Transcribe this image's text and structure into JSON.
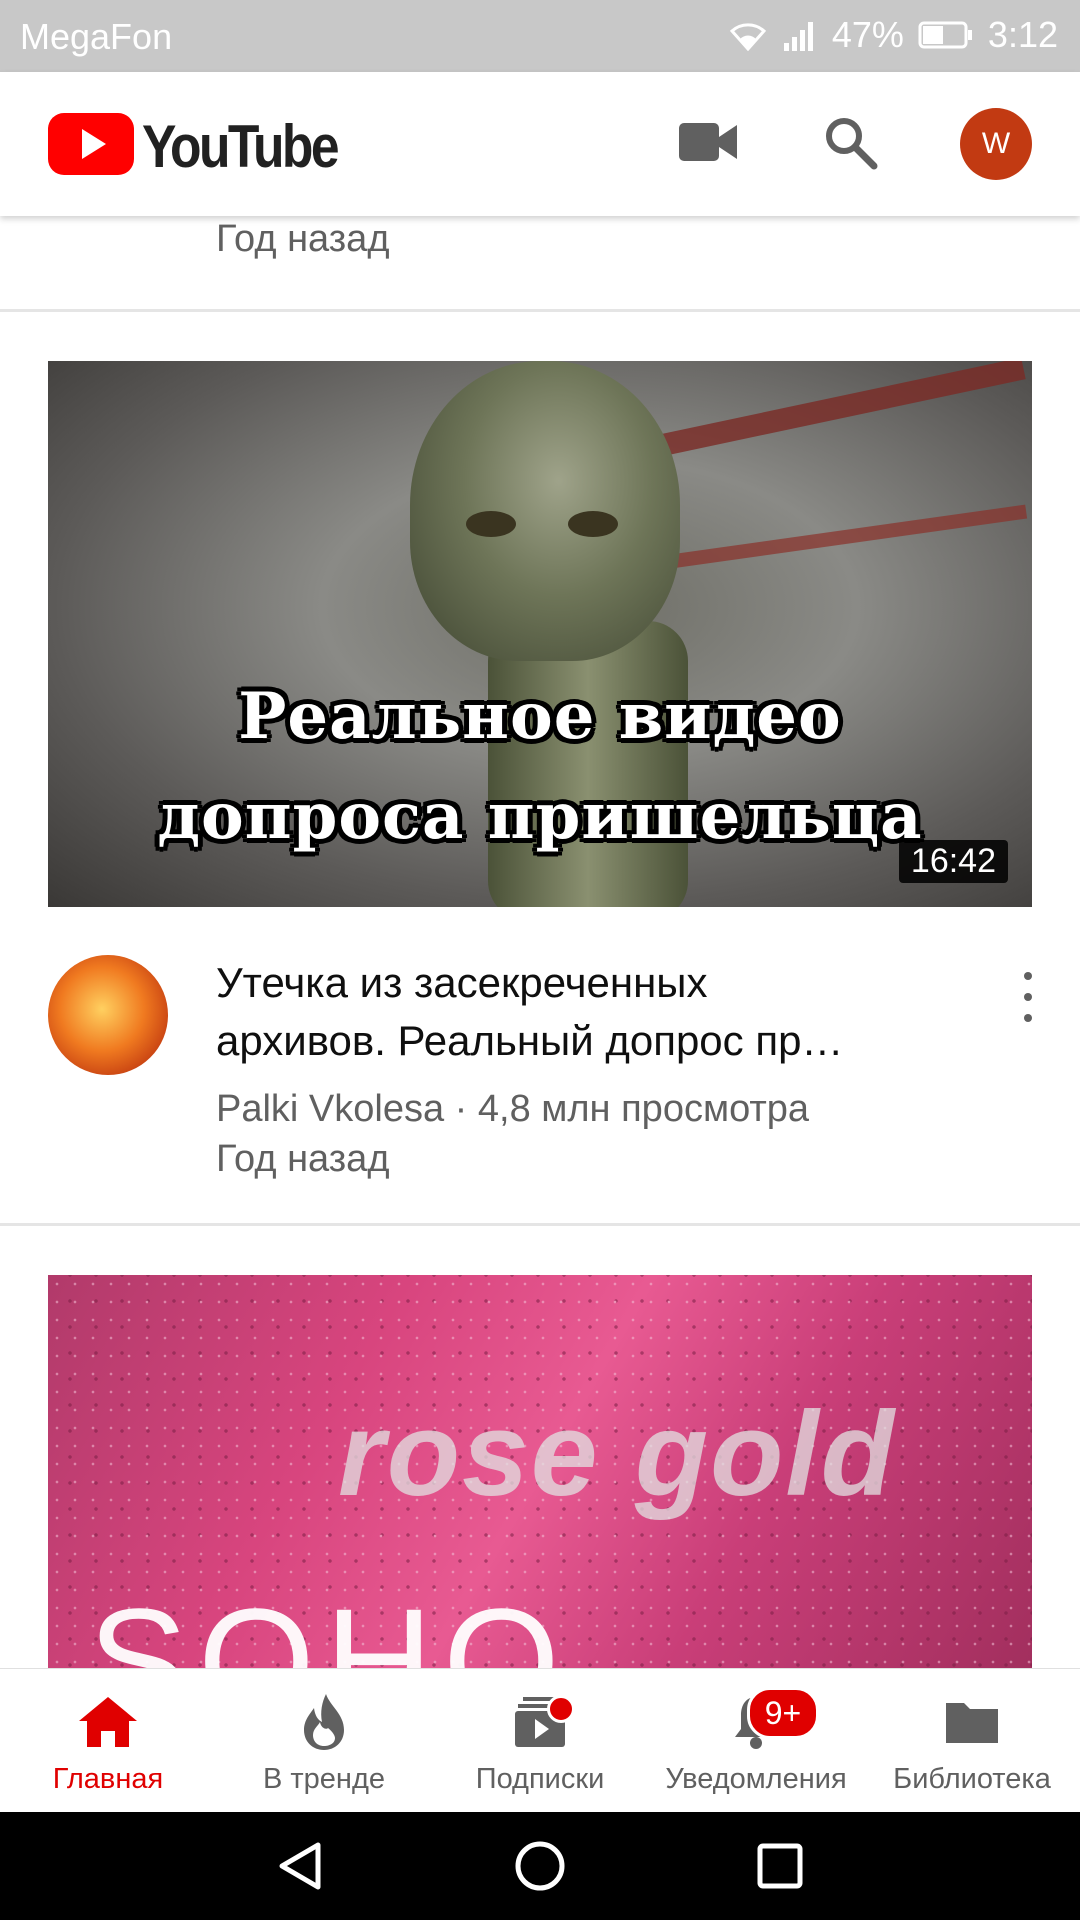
{
  "status_bar": {
    "carrier": "MegaFon",
    "battery": "47%",
    "time": "3:12"
  },
  "header": {
    "logo_text": "YouTube",
    "avatar_letter": "W",
    "icons": [
      "video-camera-icon",
      "search-icon"
    ]
  },
  "feed": {
    "prev_meta": "Год назад",
    "video": {
      "thumbnail_line1": "Реальное видео",
      "thumbnail_line2": "допроса пришельца",
      "duration": "16:42",
      "title_line1": "Утечка из засекреченных",
      "title_line2": "архивов. Реальный допрос пр…",
      "channel_views": "Palki Vkolesa · 4,8 млн просмотра",
      "age": "Год назад"
    },
    "next_video": {
      "thumbnail_text1": "rose gold",
      "thumbnail_text2": "SOHO"
    }
  },
  "bottom_nav": {
    "items": [
      {
        "label": "Главная",
        "icon": "home-icon",
        "active": true
      },
      {
        "label": "В тренде",
        "icon": "trending-flame-icon"
      },
      {
        "label": "Подписки",
        "icon": "subscriptions-icon"
      },
      {
        "label": "Уведомления",
        "icon": "bell-icon",
        "badge": "9+"
      },
      {
        "label": "Библиотека",
        "icon": "library-folder-icon"
      }
    ]
  },
  "colors": {
    "accent": "#e00000",
    "avatar": "#c23a12",
    "status_bar": "#c8c8c8"
  }
}
